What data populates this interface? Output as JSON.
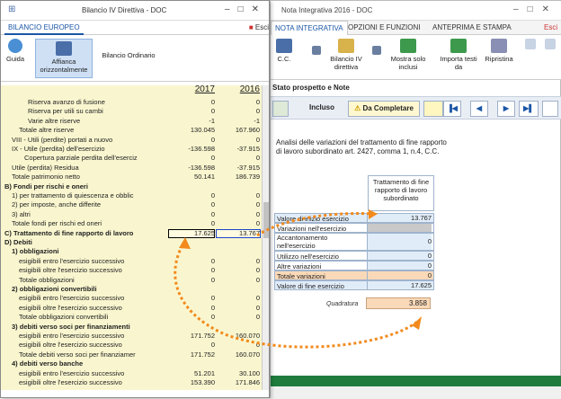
{
  "front": {
    "title": "Bilancio IV Direttiva - DOC",
    "tab": "BILANCIO EUROPEO",
    "esci": "Esci",
    "ribbon": {
      "guida": "Guida",
      "affianca": "Affianca orizzontalmente",
      "ordinario": "Bilancio Ordinario"
    },
    "years": [
      "2017",
      "2016"
    ],
    "rows": [
      {
        "label": "Riserva avanzo di fusione",
        "indent": 48,
        "v1": "0",
        "v2": "0"
      },
      {
        "label": "Riserva per utili su cambi",
        "indent": 48,
        "v1": "0",
        "v2": "0"
      },
      {
        "label": "Varie altre riserve",
        "indent": 48,
        "v1": "-1",
        "v2": "-1"
      },
      {
        "label": "Totale altre riserve",
        "indent": 38,
        "v1": "130.045",
        "v2": "167.960"
      },
      {
        "label": "VIII - Utili (perdite) portati a nuovo",
        "indent": 30,
        "v1": "0",
        "v2": "0"
      },
      {
        "label": "IX - Utile (perdita) dell'esercizio",
        "indent": 30,
        "v1": "-136.598",
        "v2": "-37.915"
      },
      {
        "label": "Copertura parziale perdita dell'eserciz",
        "indent": 44,
        "v1": "0",
        "v2": "0"
      },
      {
        "label": "Utile (perdita) Residua",
        "indent": 30,
        "v1": "-136.598",
        "v2": "-37.915"
      },
      {
        "label": "Totale patrimonio netto",
        "indent": 30,
        "v1": "50.141",
        "v2": "186.739"
      },
      {
        "label": "B) Fondi per rischi e oneri",
        "indent": 22,
        "bold": true,
        "v1": "",
        "v2": ""
      },
      {
        "label": "1) per trattamento di quiescenza e obblic",
        "indent": 30,
        "v1": "0",
        "v2": "0"
      },
      {
        "label": "2) per imposte, anche differite",
        "indent": 30,
        "v1": "0",
        "v2": "0"
      },
      {
        "label": "3) altri",
        "indent": 30,
        "v1": "0",
        "v2": "0"
      },
      {
        "label": "Totale fondi per rischi ed oneri",
        "indent": 30,
        "v1": "0",
        "v2": "0"
      },
      {
        "label": "C) Trattamento di fine rapporto di lavoro",
        "indent": 22,
        "bold": true,
        "v1": "17.625",
        "v2": "13.767",
        "hl": true
      },
      {
        "label": "D) Debiti",
        "indent": 22,
        "bold": true,
        "v1": "",
        "v2": ""
      },
      {
        "label": "1) obbligazioni",
        "indent": 30,
        "bold": true,
        "v1": "",
        "v2": ""
      },
      {
        "label": "esigibili entro l'esercizio successivo",
        "indent": 38,
        "v1": "0",
        "v2": "0"
      },
      {
        "label": "esigibili oltre l'esercizio successivo",
        "indent": 38,
        "v1": "0",
        "v2": "0"
      },
      {
        "label": "Totale obbligazioni",
        "indent": 38,
        "v1": "0",
        "v2": "0"
      },
      {
        "label": "2) obbligazioni convertibili",
        "indent": 30,
        "bold": true,
        "v1": "",
        "v2": ""
      },
      {
        "label": "esigibili entro l'esercizio successivo",
        "indent": 38,
        "v1": "0",
        "v2": "0"
      },
      {
        "label": "esigibili oltre l'esercizio successivo",
        "indent": 38,
        "v1": "0",
        "v2": "0"
      },
      {
        "label": "Totale obbligazioni convertibili",
        "indent": 38,
        "v1": "0",
        "v2": "0"
      },
      {
        "label": "3) debiti verso soci per finanziamenti",
        "indent": 30,
        "bold": true,
        "v1": "",
        "v2": ""
      },
      {
        "label": "esigibili entro l'esercizio successivo",
        "indent": 38,
        "v1": "171.752",
        "v2": "160.070"
      },
      {
        "label": "esigibili oltre l'esercizio successivo",
        "indent": 38,
        "v1": "0",
        "v2": "0"
      },
      {
        "label": "Totale debiti verso soci per finanziamer",
        "indent": 38,
        "v1": "171.752",
        "v2": "160.070"
      },
      {
        "label": "4) debiti verso banche",
        "indent": 30,
        "bold": true,
        "v1": "",
        "v2": ""
      },
      {
        "label": "esigibili entro l'esercizio successivo",
        "indent": 38,
        "v1": "51.201",
        "v2": "30.100"
      },
      {
        "label": "esigibili oltre l'esercizio successivo",
        "indent": 38,
        "v1": "153.390",
        "v2": "171.846"
      }
    ]
  },
  "back": {
    "title": "Nota Integrativa 2016 - DOC",
    "tabs": [
      "NOTA INTEGRATIVA",
      "OPZIONI E FUNZIONI",
      "ANTEPRIMA E STAMPA",
      "Esci"
    ],
    "ribbon": {
      "cc": "C.C.",
      "bilancio": "Bilancio IV direttiva",
      "mostra": "Mostra solo inclusi",
      "importa": "Importa testi da",
      "ripristina": "Ripristina"
    },
    "section": "Stato prospetto e Note",
    "incluso": "Incluso",
    "completare": "Da Completare",
    "description": "Analisi delle variazioni del trattamento di fine rapporto di lavoro subordinato art. 2427, comma 1, n.4, C.C.",
    "col_header": "Trattamento di fine rapporto di lavoro subordinato",
    "tfr_rows": [
      {
        "label": "Valore di inizio esercizio",
        "value": "13.767",
        "bg": "#e0ecf8"
      },
      {
        "label": "Variazioni nell'esercizio",
        "value": "",
        "bg": "#fff",
        "grey": true
      },
      {
        "label": "Accantonamento nell'esercizio",
        "value": "0",
        "bg": "#fff",
        "h": 20
      },
      {
        "label": "Utilizzo nell'esercizio",
        "value": "0",
        "bg": "#fff"
      },
      {
        "label": "Altre variazioni",
        "value": "0",
        "bg": "#fff"
      },
      {
        "label": "Totale variazioni",
        "value": "0",
        "bg": "#fad9b8"
      },
      {
        "label": "Valore di fine esercizio",
        "value": "17.625",
        "bg": "#e0ecf8"
      }
    ],
    "quadratura_label": "Quadratura",
    "quadratura_value": "3.858"
  },
  "colors": {
    "accent": "#1a56a6",
    "status_bar": "#1f7c3d",
    "grid_bg": "#f9f6cf",
    "arrow": "#f28a1c"
  }
}
